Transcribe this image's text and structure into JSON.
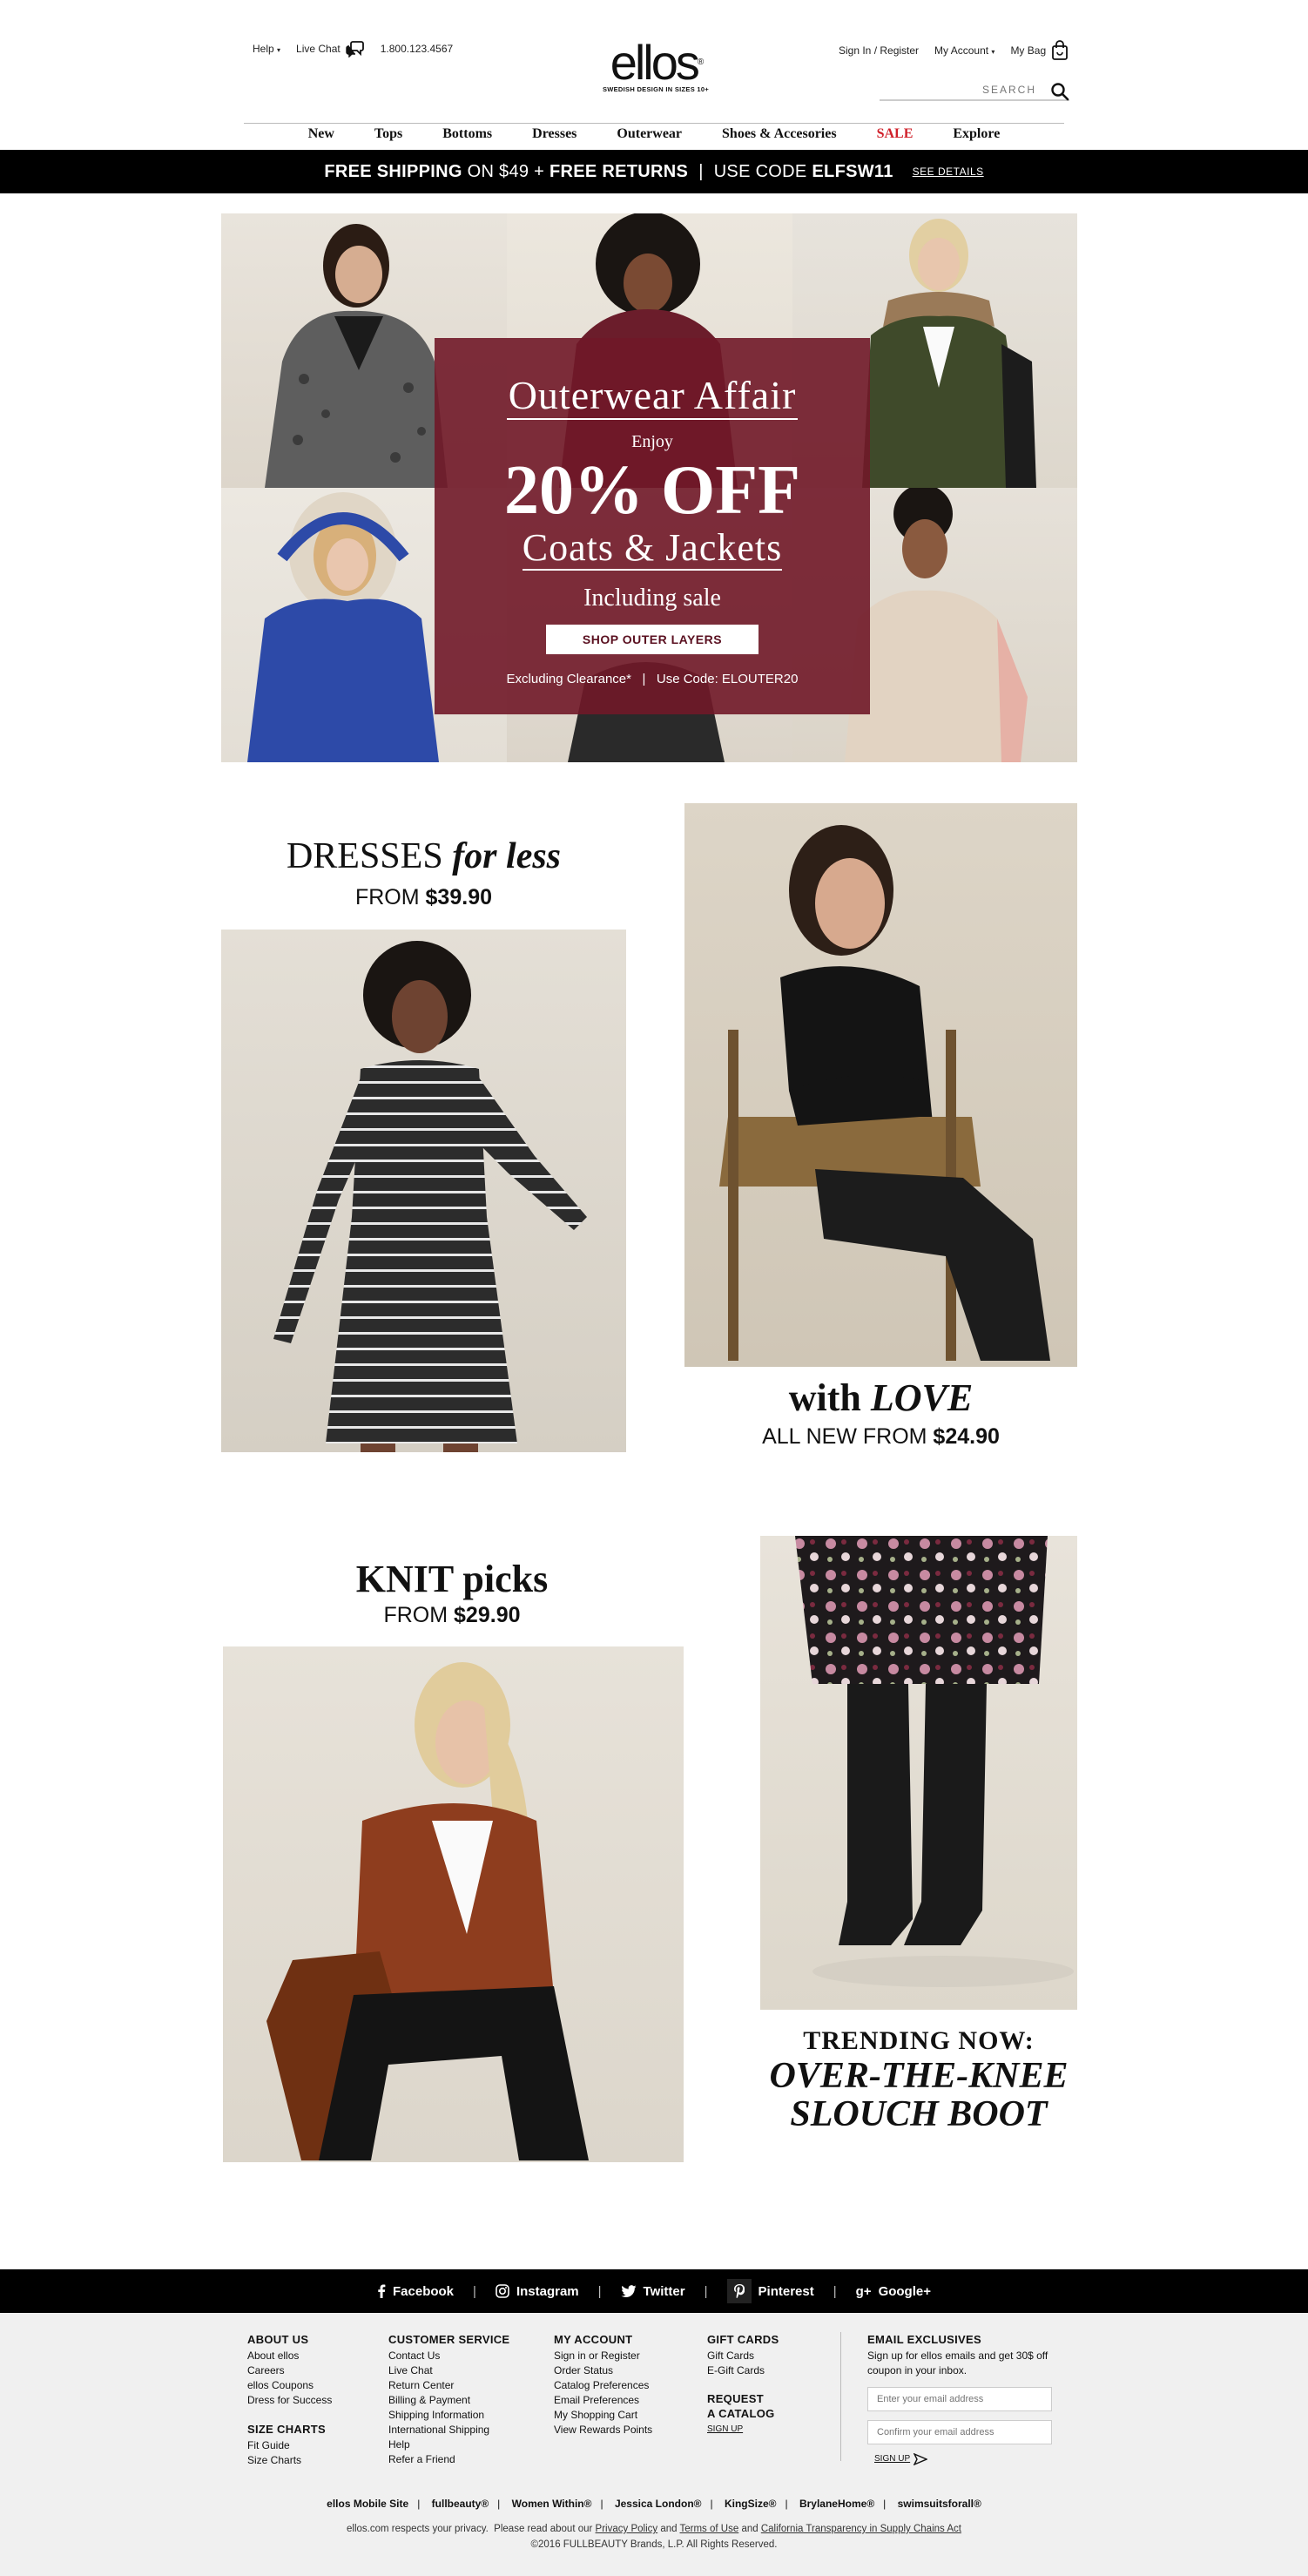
{
  "header": {
    "help": "Help",
    "live_chat": "Live Chat",
    "phone": "1.800.123.4567",
    "logo_word": "ellos",
    "logo_mark": "®",
    "logo_tagline": "SWEDISH DESIGN IN SIZES 10+",
    "sign_in": "Sign In / Register",
    "my_account": "My Account",
    "my_bag": "My Bag",
    "search_placeholder": "SEARCH"
  },
  "nav": [
    "New",
    "Tops",
    "Bottoms",
    "Dresses",
    "Outerwear",
    "Shoes & Accesories",
    "SALE",
    "Explore"
  ],
  "promo_bar": {
    "part1": "FREE SHIPPING",
    "part2": " ON $49 + ",
    "part3": "FREE RETURNS",
    "sep": "|",
    "part4": "USE CODE ",
    "code": "ELFSW11",
    "details": "SEE DETAILS"
  },
  "hero": {
    "title": "Outerwear Affair",
    "enjoy": "Enjoy",
    "discount": "20% OFF",
    "category": "Coats & Jackets",
    "including": "Including sale",
    "button": "SHOP OUTER LAYERS",
    "fine_print": "Excluding Clearance*   |   Use Code: ELOUTER20"
  },
  "dresses": {
    "title_a": "DRESSES ",
    "title_b": "for less",
    "from": "FROM ",
    "price": "$39.90"
  },
  "love": {
    "title_a": "with ",
    "title_b": "LOVE",
    "from": "ALL NEW FROM ",
    "price": "$24.90"
  },
  "knit": {
    "title": "KNIT picks",
    "from": "FROM ",
    "price": "$29.90"
  },
  "boots": {
    "line1": "TRENDING NOW:",
    "line2": "OVER-THE-KNEE",
    "line3": "SLOUCH BOOT"
  },
  "social": [
    "Facebook",
    "Instagram",
    "Twitter",
    "Pinterest",
    "Google+"
  ],
  "footer": {
    "about": {
      "heading": "ABOUT US",
      "links": [
        "About ellos",
        "Careers",
        "ellos Coupons",
        "Dress for Success"
      ]
    },
    "size_charts": {
      "heading": "SIZE CHARTS",
      "links": [
        "Fit Guide",
        "Size Charts"
      ]
    },
    "customer_service": {
      "heading": "CUSTOMER SERVICE",
      "links": [
        "Contact Us",
        "Live Chat",
        "Return Center",
        "Billing & Payment",
        "Shipping Information",
        "International Shipping",
        "Help",
        "Refer a Friend"
      ]
    },
    "my_account": {
      "heading": "MY ACCOUNT",
      "links": [
        "Sign in or Register",
        "Order Status",
        "Catalog Preferences",
        "Email Preferences",
        "My Shopping Cart",
        "View Rewards Points"
      ]
    },
    "gift_cards": {
      "heading": "GIFT CARDS",
      "links": [
        "Gift Cards",
        "E-Gift Cards"
      ]
    },
    "catalog": {
      "heading1": "REQUEST",
      "heading2": "A CATALOG",
      "signup": "SIGN UP"
    },
    "email": {
      "heading": "EMAIL EXCLUSIVES",
      "text": "Sign up for ellos emails and get 30$ off coupon in your inbox.",
      "placeholder1": "Enter your email address",
      "placeholder2": "Confirm your email address",
      "signup": "SIGN UP"
    },
    "brands": [
      "ellos Mobile Site",
      "fullbeauty®",
      "Women Within®",
      "Jessica London®",
      "KingSize®",
      "BrylaneHome®",
      "swimsuitsforall®"
    ],
    "privacy_pre": "ellos.com respects your privacy.  Please read about our ",
    "privacy_link": "Privacy Policy",
    "and1": " and ",
    "terms_link": "Terms of Use",
    "and2": " and ",
    "california_link": "California Transparency in Supply Chains Act",
    "copyright": "©2016 FULLBEAUTY Brands, L.P. All Rights Reserved."
  }
}
